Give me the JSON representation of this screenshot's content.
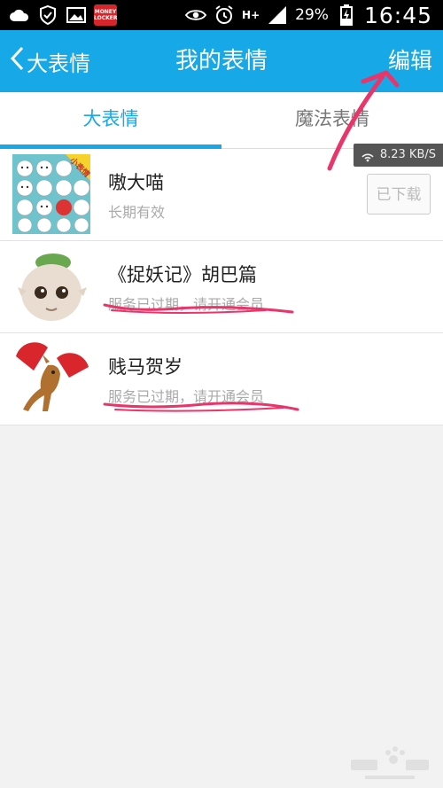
{
  "status_bar": {
    "money_badge": "MONEY LOCKER",
    "signal_label": "H+",
    "battery": "29%",
    "time": "16:45"
  },
  "header": {
    "back_label": "大表情",
    "title": "我的表情",
    "edit_label": "编辑"
  },
  "tabs": [
    {
      "label": "大表情",
      "active": true
    },
    {
      "label": "魔法表情",
      "active": false
    }
  ],
  "items": [
    {
      "name": "嗷大喵",
      "subtitle": "长期有效",
      "thumb_badge": "小表情",
      "button_label": "已下载"
    },
    {
      "name": "《捉妖记》胡巴篇",
      "subtitle": "服务已过期，请开通会员"
    },
    {
      "name": "贱马贺岁",
      "subtitle": "服务已过期，请开通会员"
    }
  ],
  "download_speed": "8.23 KB/S",
  "icons": {
    "cloud": "cloud-icon",
    "shield": "shield-icon",
    "image": "image-icon",
    "eye": "eye-icon",
    "alarm": "alarm-icon",
    "signal": "signal-icon",
    "battery": "battery-charging-icon",
    "back": "chevron-left-icon"
  },
  "colors": {
    "accent": "#17a8e8",
    "annotation": "#e8356a",
    "status_bar": "#000000"
  }
}
